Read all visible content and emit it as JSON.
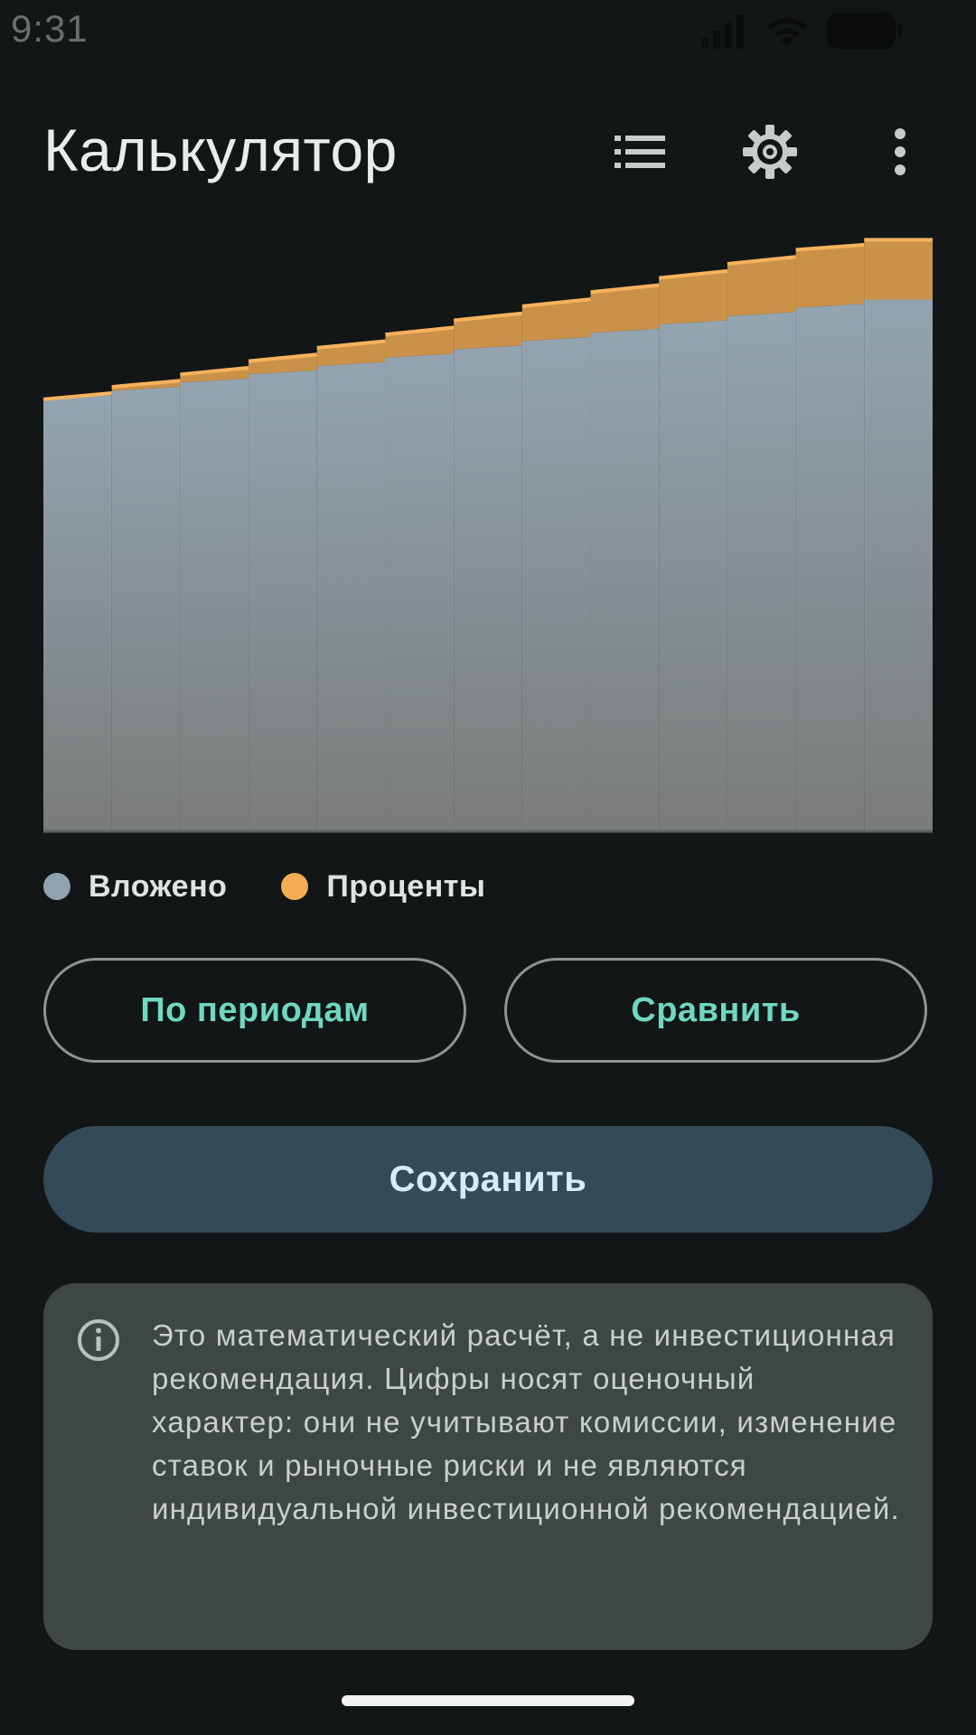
{
  "status_bar": {
    "time": "9:31",
    "icons": [
      "signal-icon",
      "wifi-icon",
      "battery-icon"
    ]
  },
  "app_bar": {
    "title": "Калькулятор",
    "actions": [
      "list-icon",
      "gear-icon",
      "more-vert-icon"
    ]
  },
  "colors": {
    "background": "#121616",
    "invested": "#8fa3b1",
    "interest": "#f3ad54",
    "accent_text": "#6fd7c2",
    "save_button": "#334a58",
    "info_card": "#3f4746"
  },
  "chart_data": {
    "type": "area",
    "stacked": true,
    "step": true,
    "grid": false,
    "legend_position": "bottom-left",
    "x": [
      0,
      1,
      2,
      3,
      4,
      5,
      6,
      7,
      8,
      9,
      10,
      11,
      12
    ],
    "series": [
      {
        "name": "Вложено",
        "color": "#8fa3b1",
        "values": [
          520,
          530,
          540,
          550,
          560,
          570,
          580,
          590,
          600,
          610,
          620,
          630,
          640
        ]
      },
      {
        "name": "Проценты",
        "color": "#f3ad54",
        "values": [
          0,
          5,
          10,
          16,
          22,
          28,
          35,
          42,
          49,
          56,
          63,
          70,
          72
        ]
      }
    ],
    "ylim": [
      0,
      720
    ]
  },
  "legend": {
    "invested_label": "Вложено",
    "interest_label": "Проценты"
  },
  "buttons": {
    "periods_label": "По периодам",
    "compare_label": "Сравнить",
    "save_label": "Сохранить"
  },
  "info": {
    "icon": "info-icon",
    "text": "Это математический расчёт, а не инвестиционная рекомендация. Цифры носят оценочный характер: они не учитывают комиссии, изменение ставок и рыночные риски и не являются индивидуальной инвестиционной рекомендацией."
  }
}
